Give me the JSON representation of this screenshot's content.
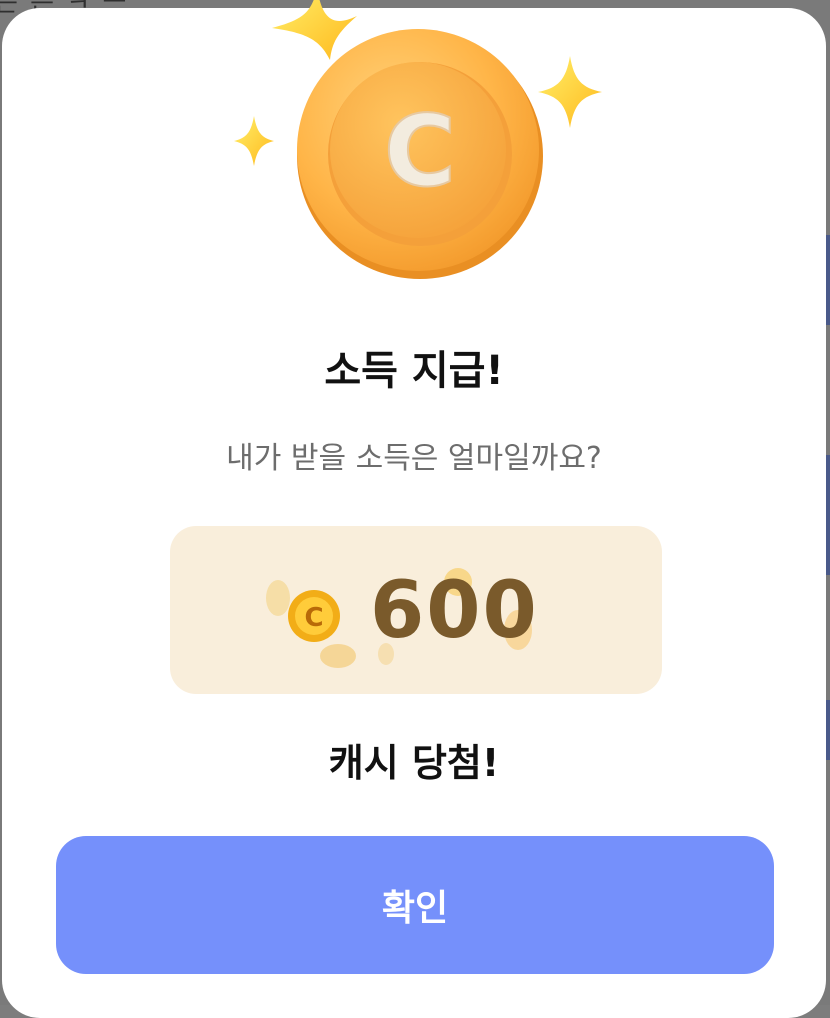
{
  "backdrop": {
    "partial_text": "는 는 ㅋ ㅡ"
  },
  "dialog": {
    "title": "소득 지급!",
    "subtitle": "내가 받을 소득은 얼마일까요?",
    "reward": {
      "currency_icon": "cash-coin-icon",
      "coin_letter": "C",
      "amount": "600"
    },
    "result_text": "캐시 당첨!",
    "confirm_label": "확인"
  },
  "colors": {
    "accent_button": "#7590fb",
    "amount_box_bg": "#f9eedb",
    "amount_text": "#7a5a2b",
    "coin_orange": "#ffb347",
    "star_yellow": "#ffc928"
  }
}
